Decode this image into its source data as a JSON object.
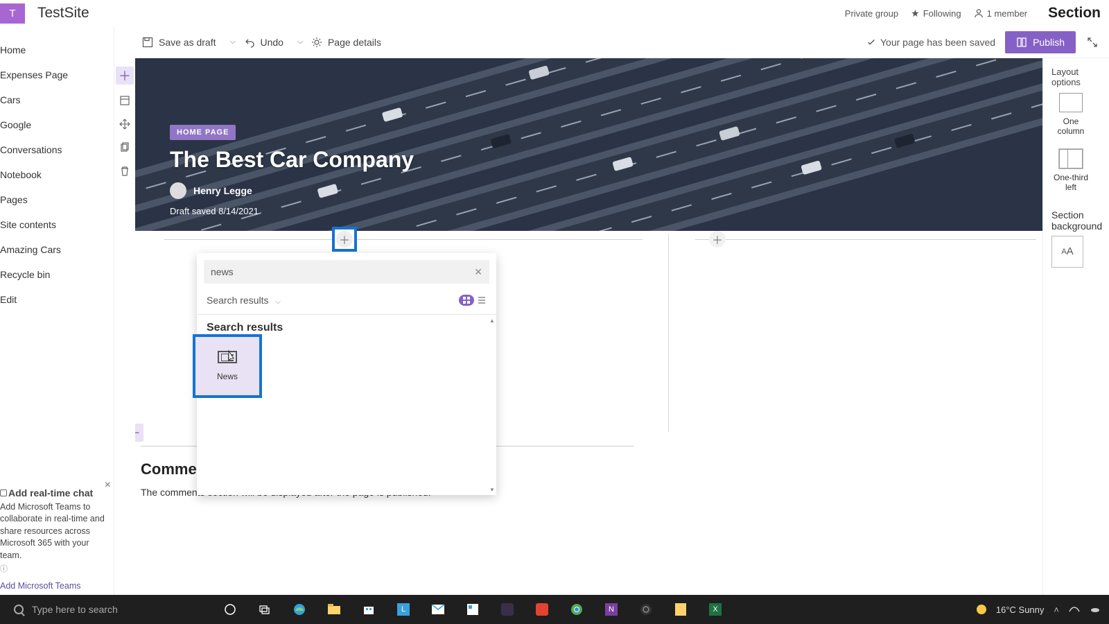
{
  "site": {
    "logo_letter": "T",
    "name": "TestSite",
    "privacy": "Private group",
    "following": "Following",
    "members": "1 member"
  },
  "commandbar": {
    "save_draft": "Save as draft",
    "undo": "Undo",
    "page_details": "Page details",
    "saved_msg": "Your page has been saved",
    "publish": "Publish"
  },
  "leftnav": [
    "Home",
    "Expenses Page",
    "Cars",
    "Google",
    "Conversations",
    "Notebook",
    "Pages",
    "Site contents",
    "Amazing Cars",
    "Recycle bin",
    "Edit"
  ],
  "hero": {
    "badge": "HOME PAGE",
    "title": "The Best Car Company",
    "author": "Henry Legge",
    "draft_saved": "Draft saved 8/14/2021"
  },
  "picker": {
    "search_value": "news",
    "category": "Search results",
    "results_header": "Search results",
    "results": [
      {
        "label": "News"
      }
    ]
  },
  "comments": {
    "header": "Comments",
    "note": "The comments section will be displayed after the page is published."
  },
  "promo": {
    "title": "Add real-time chat",
    "desc": "Add Microsoft Teams to collaborate in real-time and share resources across Microsoft 365 with your team.",
    "link": "Add Microsoft Teams"
  },
  "right_panel": {
    "title": "Section",
    "layout_option": "Layout options",
    "one_column": "One column",
    "one_third_left": "One-third left",
    "bg_label": "Section background"
  },
  "taskbar": {
    "search_placeholder": "Type here to search",
    "weather": "16°C  Sunny"
  }
}
